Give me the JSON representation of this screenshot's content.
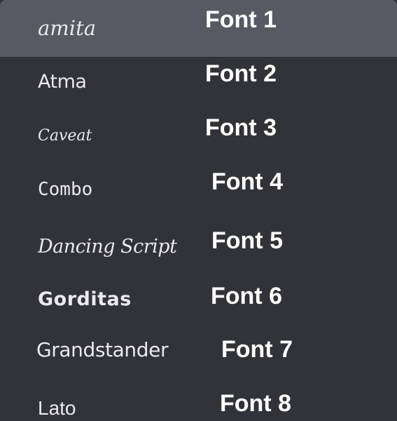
{
  "menu": {
    "highlight_color": "#575a62",
    "background_color": "#323338",
    "items": [
      {
        "font_name": "amita",
        "caption": "Font 1",
        "selected": true
      },
      {
        "font_name": "Atma",
        "caption": "Font 2"
      },
      {
        "font_name": "Caveat",
        "caption": "Font 3"
      },
      {
        "font_name": "Combo",
        "caption": "Font 4"
      },
      {
        "font_name": "Dancing Script",
        "caption": "Font 5"
      },
      {
        "font_name": "Gorditas",
        "caption": "Font 6"
      },
      {
        "font_name": "Grandstander",
        "caption": "Font 7"
      },
      {
        "font_name": "Lato",
        "caption": "Font 8"
      }
    ]
  }
}
